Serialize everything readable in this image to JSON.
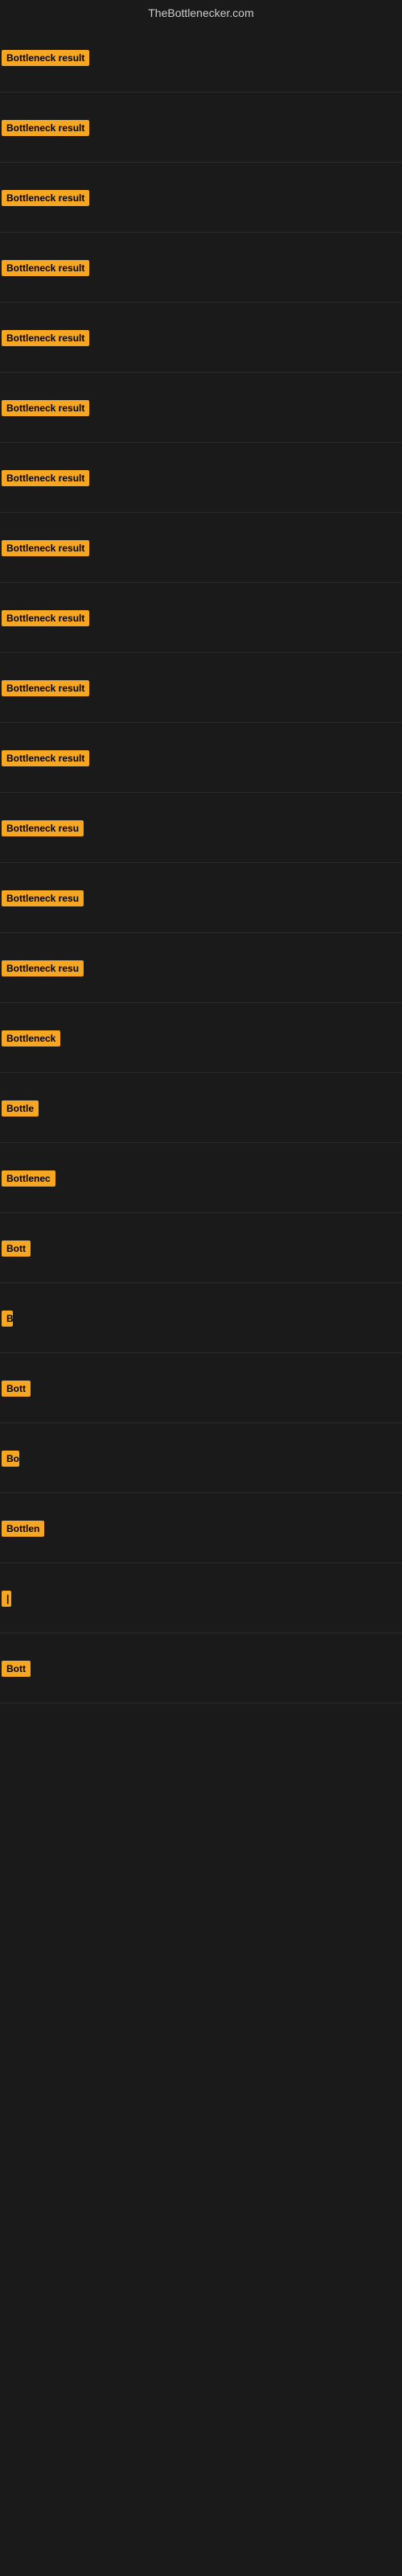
{
  "header": {
    "title": "TheBottlenecker.com"
  },
  "rows": [
    {
      "label": "Bottleneck result",
      "width": 120
    },
    {
      "label": "Bottleneck result",
      "width": 120
    },
    {
      "label": "Bottleneck result",
      "width": 120
    },
    {
      "label": "Bottleneck result",
      "width": 120
    },
    {
      "label": "Bottleneck result",
      "width": 120
    },
    {
      "label": "Bottleneck result",
      "width": 120
    },
    {
      "label": "Bottleneck result",
      "width": 120
    },
    {
      "label": "Bottleneck result",
      "width": 120
    },
    {
      "label": "Bottleneck result",
      "width": 120
    },
    {
      "label": "Bottleneck result",
      "width": 120
    },
    {
      "label": "Bottleneck result",
      "width": 120
    },
    {
      "label": "Bottleneck resu",
      "width": 105
    },
    {
      "label": "Bottleneck resu",
      "width": 105
    },
    {
      "label": "Bottleneck resu",
      "width": 105
    },
    {
      "label": "Bottleneck",
      "width": 78
    },
    {
      "label": "Bottle",
      "width": 50
    },
    {
      "label": "Bottlenec",
      "width": 68
    },
    {
      "label": "Bott",
      "width": 38
    },
    {
      "label": "B",
      "width": 14
    },
    {
      "label": "Bott",
      "width": 38
    },
    {
      "label": "Bo",
      "width": 22
    },
    {
      "label": "Bottlen",
      "width": 56
    },
    {
      "label": "|",
      "width": 6
    },
    {
      "label": "Bott",
      "width": 38
    }
  ]
}
